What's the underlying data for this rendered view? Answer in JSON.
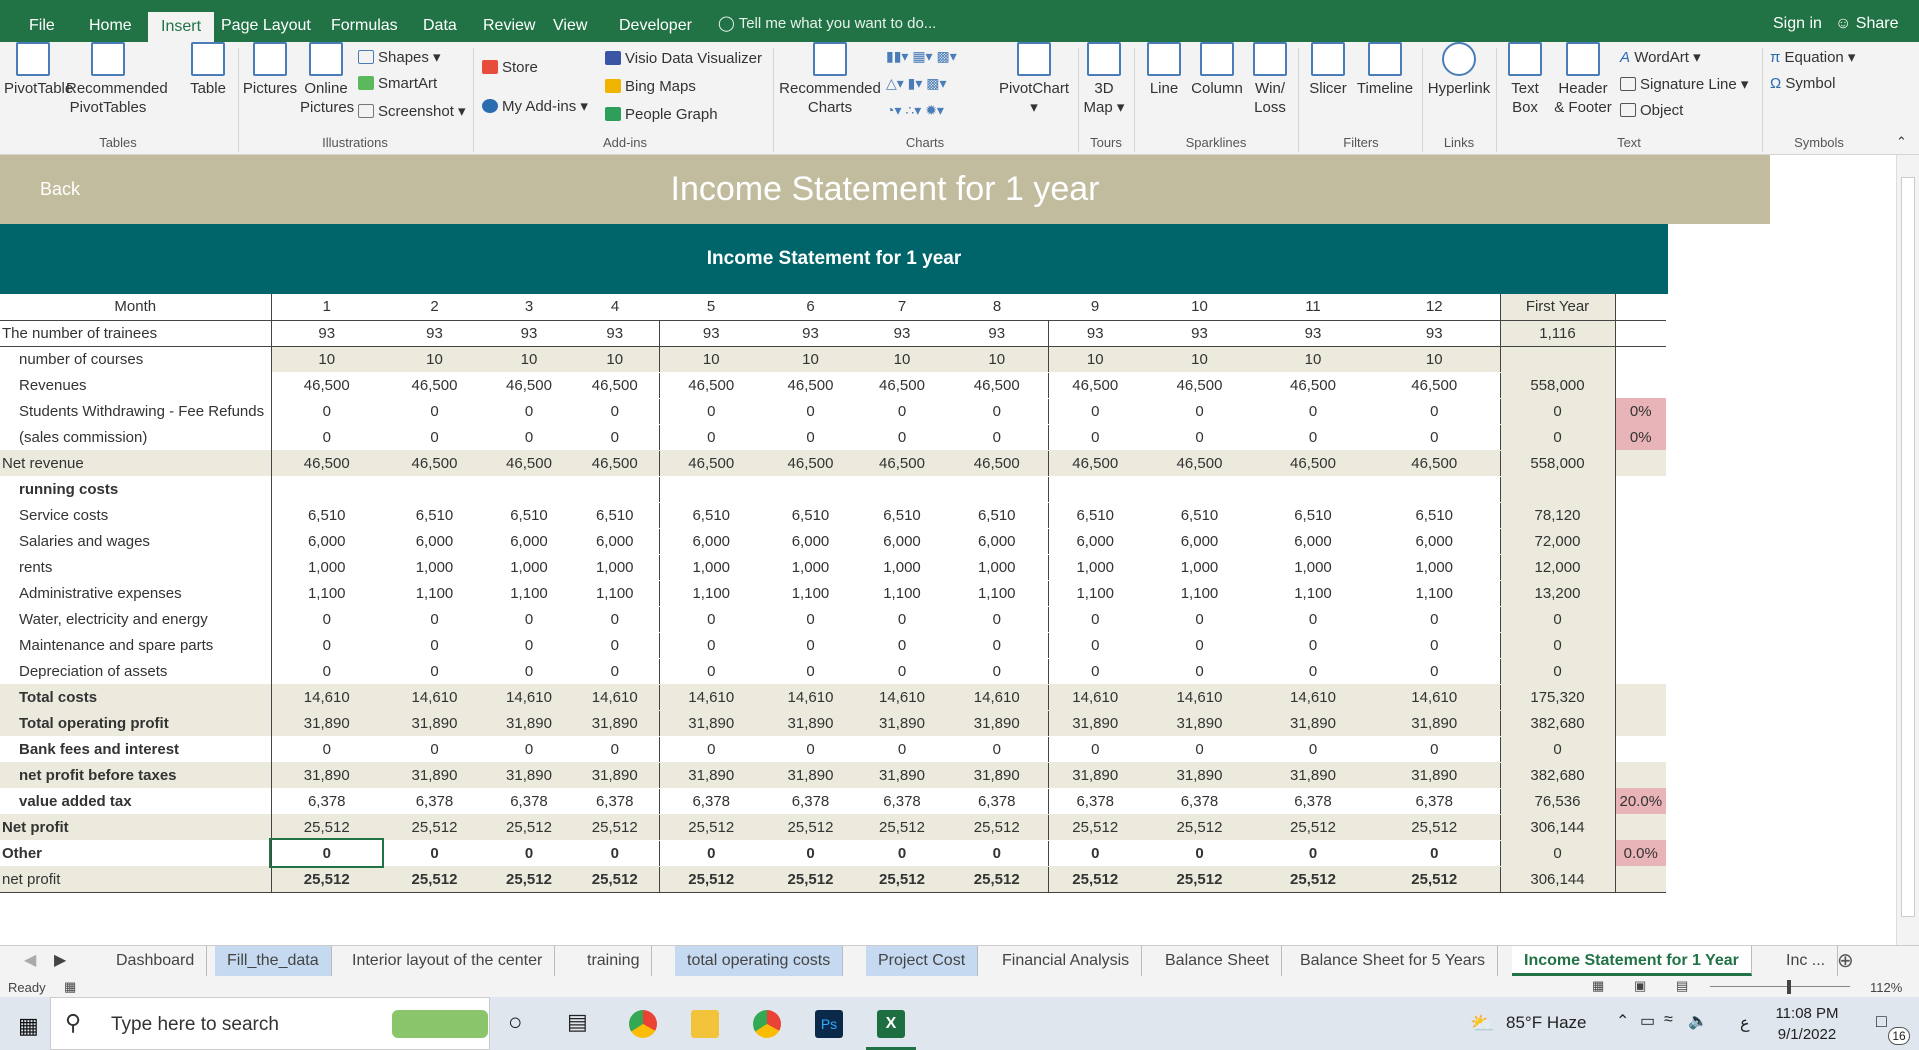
{
  "ribbon_tabs": [
    "File",
    "Home",
    "Insert",
    "Page Layout",
    "Formulas",
    "Data",
    "Review",
    "View",
    "Developer"
  ],
  "active_tab": "Insert",
  "tell_me": "Tell me what you want to do...",
  "sign_in": "Sign in",
  "share": "Share",
  "ribbon": {
    "groups": [
      "Tables",
      "Illustrations",
      "Add-ins",
      "Charts",
      "Tours",
      "Sparklines",
      "Filters",
      "Links",
      "Text",
      "Symbols"
    ],
    "pivottable": "PivotTable",
    "recommended_pivot_1": "Recommended",
    "recommended_pivot_2": "PivotTables",
    "table": "Table",
    "pictures": "Pictures",
    "online_1": "Online",
    "online_2": "Pictures",
    "shapes": "Shapes",
    "smartart": "SmartArt",
    "screenshot": "Screenshot",
    "store": "Store",
    "my_addins": "My Add-ins",
    "visio": "Visio Data Visualizer",
    "bing_maps": "Bing Maps",
    "people_graph": "People Graph",
    "rec_charts_1": "Recommended",
    "rec_charts_2": "Charts",
    "pivotchart": "PivotChart",
    "map3d_1": "3D",
    "map3d_2": "Map",
    "line": "Line",
    "column": "Column",
    "winloss_1": "Win/",
    "winloss_2": "Loss",
    "slicer": "Slicer",
    "timeline": "Timeline",
    "hyperlink": "Hyperlink",
    "textbox_1": "Text",
    "textbox_2": "Box",
    "header_1": "Header",
    "header_2": "& Footer",
    "wordart": "WordArt",
    "signature": "Signature Line",
    "object": "Object",
    "equation": "Equation",
    "symbol": "Symbol"
  },
  "sheet": {
    "back": "Back",
    "banner_title": "Income Statement for 1 year",
    "table_title": "Income Statement for 1 year",
    "header_row": [
      "Month",
      "1",
      "2",
      "3",
      "4",
      "5",
      "6",
      "7",
      "8",
      "9",
      "10",
      "11",
      "12",
      "First Year",
      ""
    ],
    "rows": [
      {
        "label": "The number of trainees",
        "vals": [
          "93",
          "93",
          "93",
          "93",
          "93",
          "93",
          "93",
          "93",
          "93",
          "93",
          "93",
          "93"
        ],
        "year": "1,116",
        "extra": ""
      },
      {
        "label": "number of courses",
        "vals": [
          "10",
          "10",
          "10",
          "10",
          "10",
          "10",
          "10",
          "10",
          "10",
          "10",
          "10",
          "10"
        ],
        "year": "",
        "extra": ""
      },
      {
        "label": "Revenues",
        "vals": [
          "46,500",
          "46,500",
          "46,500",
          "46,500",
          "46,500",
          "46,500",
          "46,500",
          "46,500",
          "46,500",
          "46,500",
          "46,500",
          "46,500"
        ],
        "year": "558,000",
        "extra": ""
      },
      {
        "label": "Students Withdrawing - Fee Refunds",
        "vals": [
          "0",
          "0",
          "0",
          "0",
          "0",
          "0",
          "0",
          "0",
          "0",
          "0",
          "0",
          "0"
        ],
        "year": "0",
        "extra": "0%"
      },
      {
        "label": "(sales commission)",
        "vals": [
          "0",
          "0",
          "0",
          "0",
          "0",
          "0",
          "0",
          "0",
          "0",
          "0",
          "0",
          "0"
        ],
        "year": "0",
        "extra": "0%"
      },
      {
        "label": "Net revenue",
        "vals": [
          "46,500",
          "46,500",
          "46,500",
          "46,500",
          "46,500",
          "46,500",
          "46,500",
          "46,500",
          "46,500",
          "46,500",
          "46,500",
          "46,500"
        ],
        "year": "558,000",
        "extra": ""
      },
      {
        "label": "running costs",
        "vals": [
          "",
          "",
          "",
          "",
          "",
          "",
          "",
          "",
          "",
          "",
          "",
          ""
        ],
        "year": "",
        "extra": ""
      },
      {
        "label": "Service costs",
        "vals": [
          "6,510",
          "6,510",
          "6,510",
          "6,510",
          "6,510",
          "6,510",
          "6,510",
          "6,510",
          "6,510",
          "6,510",
          "6,510",
          "6,510"
        ],
        "year": "78,120",
        "extra": ""
      },
      {
        "label": "Salaries and wages",
        "vals": [
          "6,000",
          "6,000",
          "6,000",
          "6,000",
          "6,000",
          "6,000",
          "6,000",
          "6,000",
          "6,000",
          "6,000",
          "6,000",
          "6,000"
        ],
        "year": "72,000",
        "extra": ""
      },
      {
        "label": "rents",
        "vals": [
          "1,000",
          "1,000",
          "1,000",
          "1,000",
          "1,000",
          "1,000",
          "1,000",
          "1,000",
          "1,000",
          "1,000",
          "1,000",
          "1,000"
        ],
        "year": "12,000",
        "extra": ""
      },
      {
        "label": "Administrative expenses",
        "vals": [
          "1,100",
          "1,100",
          "1,100",
          "1,100",
          "1,100",
          "1,100",
          "1,100",
          "1,100",
          "1,100",
          "1,100",
          "1,100",
          "1,100"
        ],
        "year": "13,200",
        "extra": ""
      },
      {
        "label": "Water, electricity and energy",
        "vals": [
          "0",
          "0",
          "0",
          "0",
          "0",
          "0",
          "0",
          "0",
          "0",
          "0",
          "0",
          "0"
        ],
        "year": "0",
        "extra": ""
      },
      {
        "label": "Maintenance and spare parts",
        "vals": [
          "0",
          "0",
          "0",
          "0",
          "0",
          "0",
          "0",
          "0",
          "0",
          "0",
          "0",
          "0"
        ],
        "year": "0",
        "extra": ""
      },
      {
        "label": "Depreciation of assets",
        "vals": [
          "0",
          "0",
          "0",
          "0",
          "0",
          "0",
          "0",
          "0",
          "0",
          "0",
          "0",
          "0"
        ],
        "year": "0",
        "extra": ""
      },
      {
        "label": "Total costs",
        "vals": [
          "14,610",
          "14,610",
          "14,610",
          "14,610",
          "14,610",
          "14,610",
          "14,610",
          "14,610",
          "14,610",
          "14,610",
          "14,610",
          "14,610"
        ],
        "year": "175,320",
        "extra": ""
      },
      {
        "label": "Total operating profit",
        "vals": [
          "31,890",
          "31,890",
          "31,890",
          "31,890",
          "31,890",
          "31,890",
          "31,890",
          "31,890",
          "31,890",
          "31,890",
          "31,890",
          "31,890"
        ],
        "year": "382,680",
        "extra": ""
      },
      {
        "label": "Bank fees and interest",
        "vals": [
          "0",
          "0",
          "0",
          "0",
          "0",
          "0",
          "0",
          "0",
          "0",
          "0",
          "0",
          "0"
        ],
        "year": "0",
        "extra": ""
      },
      {
        "label": "net profit before taxes",
        "vals": [
          "31,890",
          "31,890",
          "31,890",
          "31,890",
          "31,890",
          "31,890",
          "31,890",
          "31,890",
          "31,890",
          "31,890",
          "31,890",
          "31,890"
        ],
        "year": "382,680",
        "extra": ""
      },
      {
        "label": "value added tax",
        "vals": [
          "6,378",
          "6,378",
          "6,378",
          "6,378",
          "6,378",
          "6,378",
          "6,378",
          "6,378",
          "6,378",
          "6,378",
          "6,378",
          "6,378"
        ],
        "year": "76,536",
        "extra": "20.0%"
      },
      {
        "label": "Net profit",
        "vals": [
          "25,512",
          "25,512",
          "25,512",
          "25,512",
          "25,512",
          "25,512",
          "25,512",
          "25,512",
          "25,512",
          "25,512",
          "25,512",
          "25,512"
        ],
        "year": "306,144",
        "extra": ""
      },
      {
        "label": "Other",
        "vals": [
          "0",
          "0",
          "0",
          "0",
          "0",
          "0",
          "0",
          "0",
          "0",
          "0",
          "0",
          "0"
        ],
        "year": "0",
        "extra": "0.0%"
      },
      {
        "label": "net profit",
        "vals": [
          "25,512",
          "25,512",
          "25,512",
          "25,512",
          "25,512",
          "25,512",
          "25,512",
          "25,512",
          "25,512",
          "25,512",
          "25,512",
          "25,512"
        ],
        "year": "306,144",
        "extra": ""
      }
    ]
  },
  "sheet_tabs": [
    "Dashboard",
    "Fill_the_data",
    "Interior layout of the center",
    "training",
    "total operating costs",
    "Project Cost",
    "Financial Analysis",
    "Balance Sheet",
    "Balance Sheet for 5 Years",
    "Income Statement for 1 Year",
    "Inc ..."
  ],
  "active_sheet": "Income Statement for 1 Year",
  "status": {
    "ready": "Ready",
    "zoom": "112%"
  },
  "taskbar": {
    "search": "Type here to search",
    "weather": "85°F  Haze",
    "time": "11:08 PM",
    "date": "9/1/2022",
    "notif": "16",
    "lang": "ع"
  },
  "colors": {
    "excel_green": "#217346",
    "teal": "#00656a",
    "banner": "#c2bc9e",
    "beige": "#ece9dd",
    "pink": "#e8b4b8"
  }
}
